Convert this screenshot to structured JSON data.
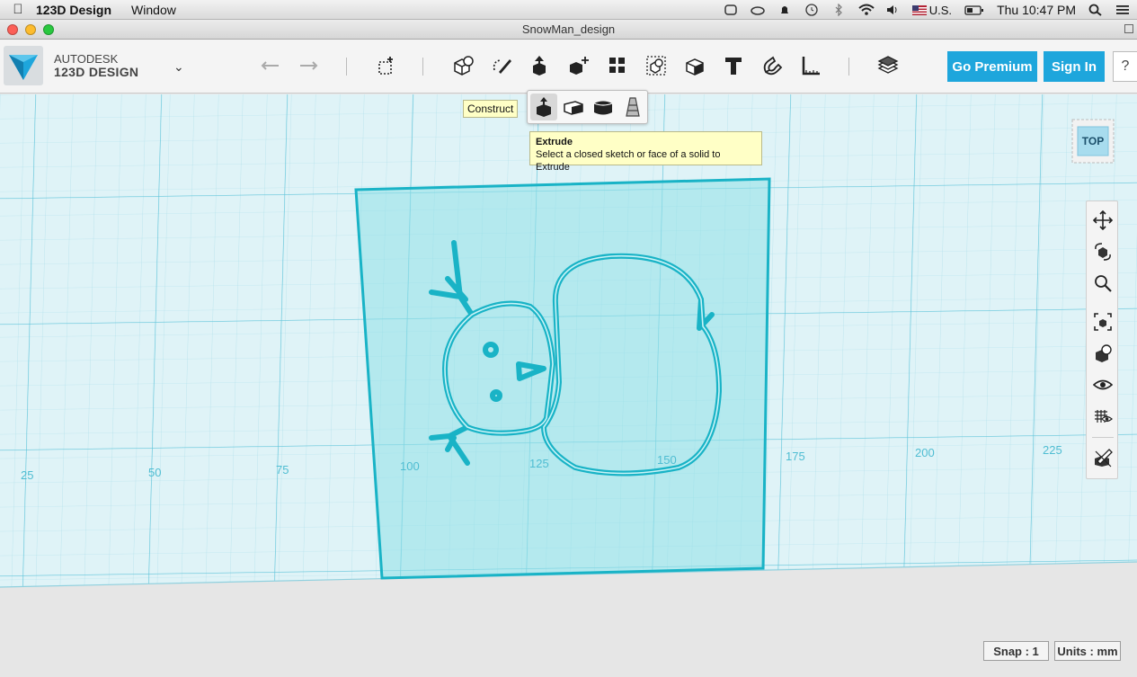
{
  "menubar": {
    "app_name": "123D Design",
    "menus": [
      "Window"
    ],
    "input_source": "U.S.",
    "clock": "Thu 10:47 PM"
  },
  "window": {
    "title": "SnowMan_design"
  },
  "brand": {
    "line1": "AUTODESK",
    "line2": "123D DESIGN"
  },
  "toolbar": {
    "tools": [
      "undo-icon",
      "redo-icon",
      "transform-icon",
      "primitives-icon",
      "sketch-icon",
      "construct-icon",
      "modify-icon",
      "pattern-icon",
      "group-icon",
      "combine-icon",
      "text-icon",
      "snap-icon",
      "measure-icon",
      "material-icon"
    ],
    "premium_label": "Go Premium",
    "signin_label": "Sign In",
    "help_label": "?"
  },
  "construct_menu": {
    "tooltip_label": "Construct",
    "items": [
      "extrude-icon",
      "sweep-icon",
      "revolve-icon",
      "loft-icon"
    ],
    "active": "extrude-icon"
  },
  "extrude_tooltip": {
    "title": "Extrude",
    "description": "Select a closed sketch or face of a solid to Extrude"
  },
  "grid_labels": [
    "25",
    "50",
    "75",
    "100",
    "125",
    "150",
    "175",
    "200",
    "225"
  ],
  "viewcube": {
    "face": "TOP"
  },
  "nav_tools": [
    "pan-icon",
    "orbit-icon",
    "zoom-icon",
    "fit-icon",
    "view-mode-icon",
    "visibility-icon",
    "grid-material-icon",
    "sketch-hide-icon"
  ],
  "status": {
    "snap": "Snap : 1",
    "units": "Units : mm"
  },
  "colors": {
    "accent": "#1ea6dc",
    "grid": "#7fd3e3",
    "sketch": "#19b3c6"
  }
}
